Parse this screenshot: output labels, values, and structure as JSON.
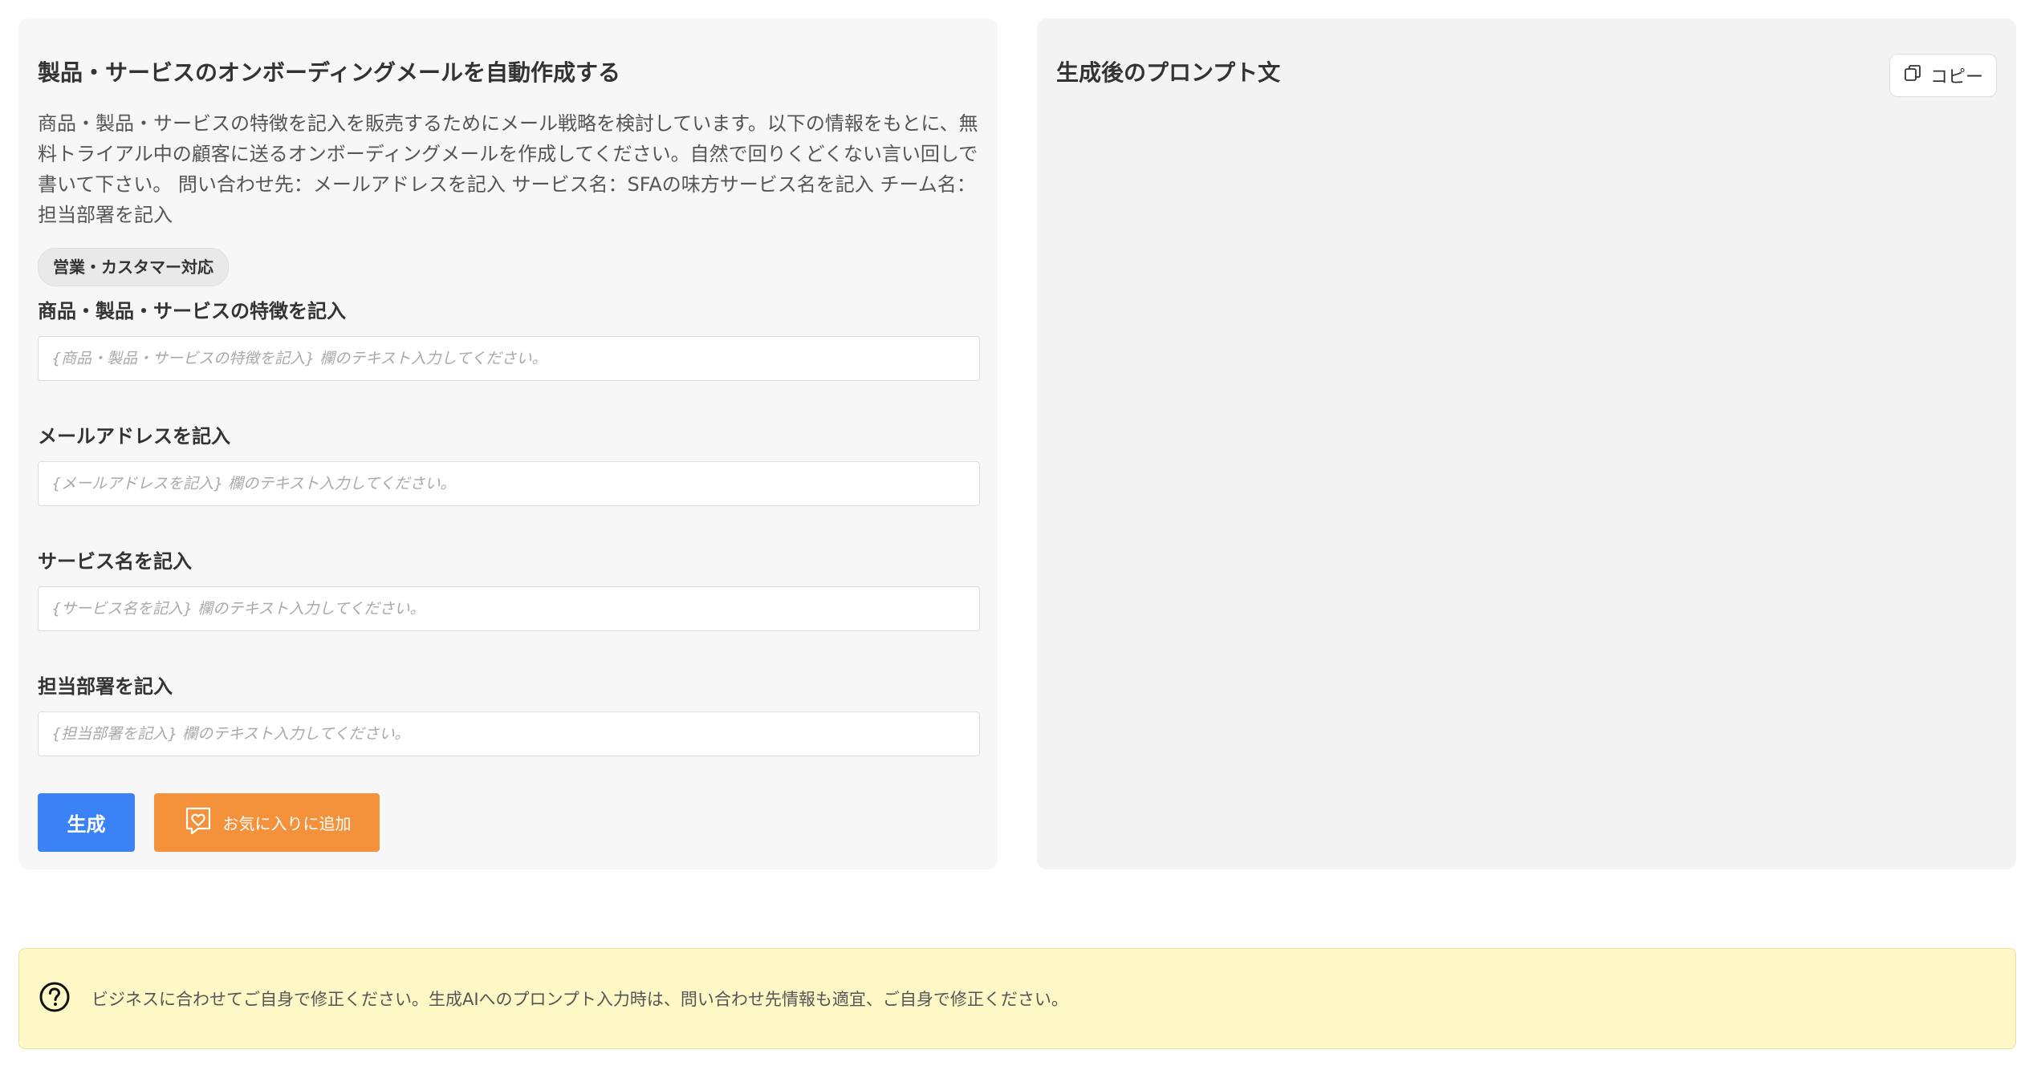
{
  "prompt": {
    "title": "製品・サービスのオンボーディングメールを自動作成する",
    "description": "商品・製品・サービスの特徴を記入を販売するためにメール戦略を検討しています。以下の情報をもとに、無料トライアル中の顧客に送るオンボーディングメールを作成してください。自然で回りくどくない言い回しで書いて下さい。 問い合わせ先：メールアドレスを記入 サービス名：SFAの味方サービス名を記入 チーム名：担当部署を記入",
    "category": "営業・カスタマー対応"
  },
  "fields": [
    {
      "label": "商品・製品・サービスの特徴を記入",
      "value": "",
      "placeholder": "{商品・製品・サービスの特徴を記入} 欄のテキスト入力してください。"
    },
    {
      "label": "メールアドレスを記入",
      "value": "",
      "placeholder": "{メールアドレスを記入} 欄のテキスト入力してください。"
    },
    {
      "label": "サービス名を記入",
      "value": "",
      "placeholder": "{サービス名を記入} 欄のテキスト入力してください。"
    },
    {
      "label": "担当部署を記入",
      "value": "",
      "placeholder": "{担当部署を記入} 欄のテキスト入力してください。"
    }
  ],
  "actions": {
    "generate_label": "生成",
    "favorite_label": "お気に入りに追加"
  },
  "output": {
    "title": "生成後のプロンプト文",
    "copy_label": "コピー",
    "content": ""
  },
  "notice": {
    "text": "ビジネスに合わせてご自身で修正ください。生成AIへのプロンプト入力時は、問い合わせ先情報も適宜、ご自身で修正ください。"
  },
  "icons": {
    "copy": "copy-icon",
    "favorite": "bookmark-heart-icon",
    "help": "question-circle-icon"
  },
  "colors": {
    "primary": "#3b82f6",
    "favorite": "#f3923a",
    "notice_bg": "#fef8c7"
  }
}
